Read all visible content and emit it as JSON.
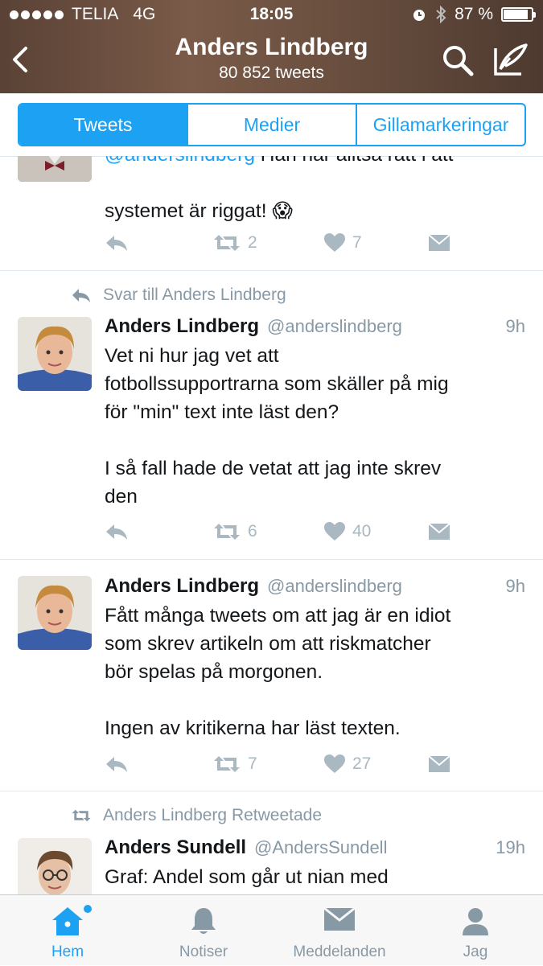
{
  "status_bar": {
    "carrier": "TELIA",
    "network": "4G",
    "time": "18:05",
    "battery": "87 %",
    "battery_level": 0.87
  },
  "header": {
    "title": "Anders Lindberg",
    "subtitle": "80 852 tweets",
    "back_icon": "chevron-left-icon",
    "search_icon": "search-icon",
    "compose_icon": "compose-icon"
  },
  "segments": {
    "items": [
      "Tweets",
      "Medier",
      "Gillamarkeringar"
    ],
    "selected": "Tweets"
  },
  "tweets": [
    {
      "mention": "@anderslindberg",
      "text_line1": " Han har alltså rätt i att",
      "text_line2": "systemet är riggat! 😱",
      "retweets": "2",
      "likes": "7"
    },
    {
      "context": "Svar till Anders Lindberg",
      "name": "Anders Lindberg",
      "handle": "@anderslindberg",
      "time": "9h",
      "text": "Vet ni hur jag vet att\nfotbollssupportrarna som skäller på mig\nför \"min\" text inte läst den?\n\nI så fall hade de vetat att jag inte skrev\nden",
      "retweets": "6",
      "likes": "40"
    },
    {
      "name": "Anders Lindberg",
      "handle": "@anderslindberg",
      "time": "9h",
      "text": "Fått många tweets om att jag är en idiot\nsom skrev artikeln om att riskmatcher\nbör spelas på morgonen.\n\nIngen av kritikerna har läst texten.",
      "retweets": "7",
      "likes": "27"
    },
    {
      "context": "Anders Lindberg Retweetade",
      "name": "Anders Sundell",
      "handle": "@AndersSundell",
      "time": "19h",
      "text": "Graf: Andel som går ut nian med"
    }
  ],
  "tab_bar": {
    "items": [
      {
        "label": "Hem",
        "icon": "home-icon"
      },
      {
        "label": "Notiser",
        "icon": "bell-icon"
      },
      {
        "label": "Meddelanden",
        "icon": "envelope-icon"
      },
      {
        "label": "Jag",
        "icon": "person-icon"
      }
    ],
    "active": "Hem"
  },
  "colors": {
    "accent": "#1da1f2",
    "muted": "#8899a6",
    "action_gray": "#aab8c2",
    "text": "#14171a"
  }
}
